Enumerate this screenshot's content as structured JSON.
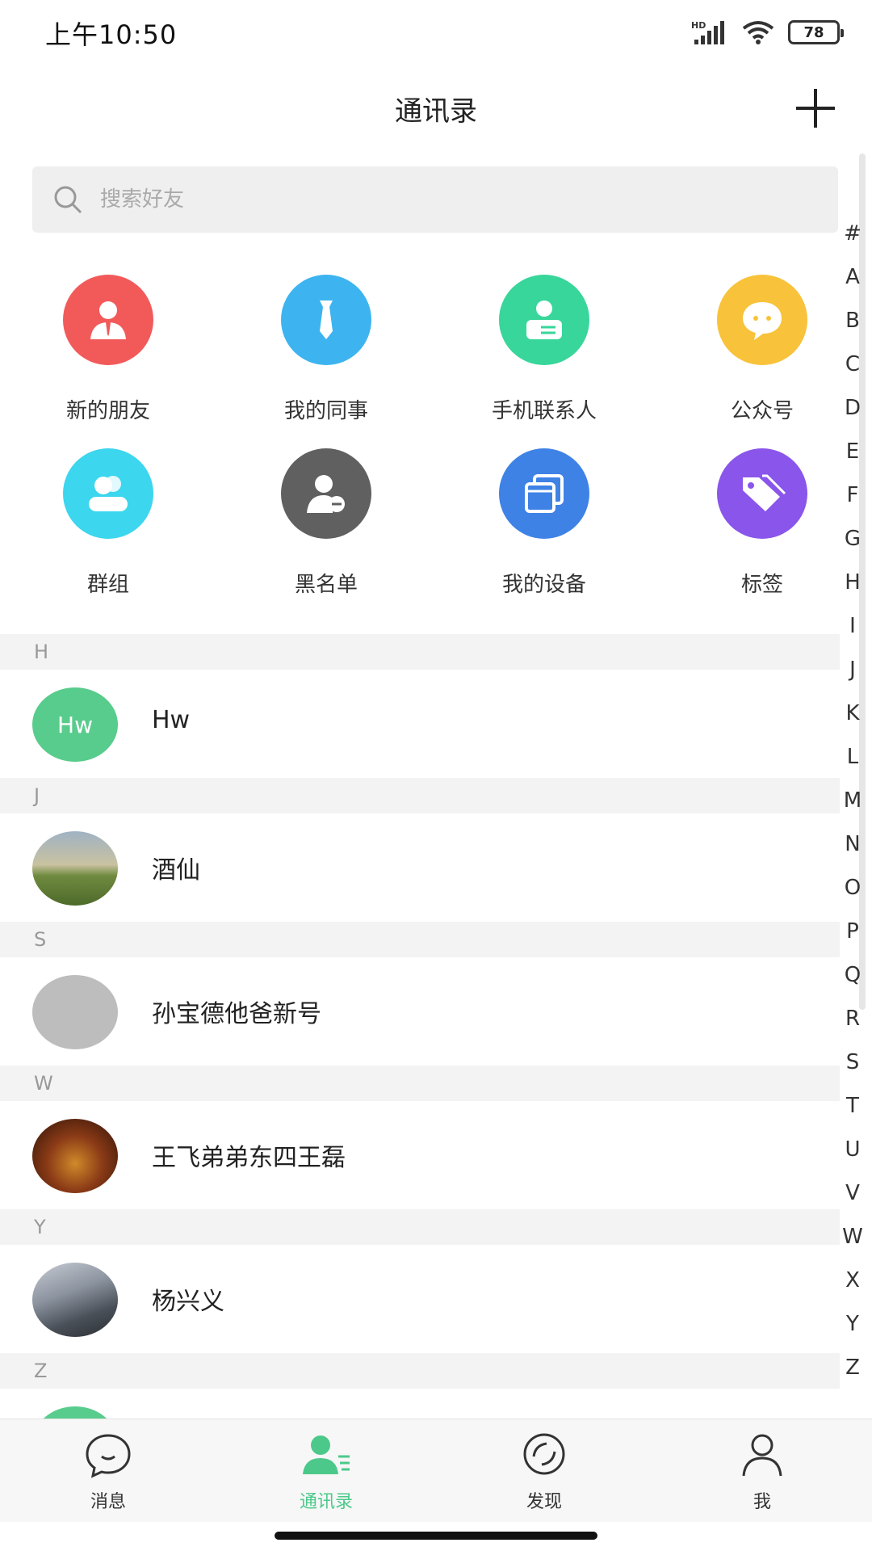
{
  "status_bar": {
    "time": "上午10:50",
    "network": "HD",
    "battery": "78"
  },
  "header": {
    "title": "通讯录",
    "add_icon": "plus-icon"
  },
  "search": {
    "placeholder": "搜索好友",
    "icon": "search-icon"
  },
  "quick_actions": [
    {
      "label": "新的朋友",
      "icon": "new-friend-icon",
      "color": "#f25a5a"
    },
    {
      "label": "我的同事",
      "icon": "colleague-icon",
      "color": "#3db4f0"
    },
    {
      "label": "手机联系人",
      "icon": "phone-contacts-icon",
      "color": "#38d69a"
    },
    {
      "label": "公众号",
      "icon": "official-account-icon",
      "color": "#f8c23a"
    },
    {
      "label": "群组",
      "icon": "group-icon",
      "color": "#3cd6ee"
    },
    {
      "label": "黑名单",
      "icon": "blacklist-icon",
      "color": "#606060"
    },
    {
      "label": "我的设备",
      "icon": "device-icon",
      "color": "#3f82e6"
    },
    {
      "label": "标签",
      "icon": "tag-icon",
      "color": "#8a55ea"
    }
  ],
  "index_letters": [
    "#",
    "A",
    "B",
    "C",
    "D",
    "E",
    "F",
    "G",
    "H",
    "I",
    "J",
    "K",
    "L",
    "M",
    "N",
    "O",
    "P",
    "Q",
    "R",
    "S",
    "T",
    "U",
    "V",
    "W",
    "X",
    "Y",
    "Z"
  ],
  "contact_sections": [
    {
      "letter": "H",
      "contacts": [
        {
          "name": "Hw",
          "avatar_text": "Hw",
          "avatar_color": "#58cc8c"
        }
      ]
    },
    {
      "letter": "J",
      "contacts": [
        {
          "name": "酒仙",
          "avatar_text": "",
          "avatar_color": "#7a8a5a"
        }
      ]
    },
    {
      "letter": "S",
      "contacts": [
        {
          "name": "孙宝德他爸新号",
          "avatar_text": "",
          "avatar_color": "#bdbdbd"
        }
      ]
    },
    {
      "letter": "W",
      "contacts": [
        {
          "name": "王飞弟弟东四王磊",
          "avatar_text": "",
          "avatar_color": "#6b3a1e"
        }
      ]
    },
    {
      "letter": "Y",
      "contacts": [
        {
          "name": "杨兴义",
          "avatar_text": "",
          "avatar_color": "#6f7a88"
        }
      ]
    },
    {
      "letter": "Z",
      "contacts": []
    }
  ],
  "bottom_nav": [
    {
      "label": "消息",
      "icon": "message-icon",
      "active": false
    },
    {
      "label": "通讯录",
      "icon": "contacts-icon",
      "active": true
    },
    {
      "label": "发现",
      "icon": "discover-icon",
      "active": false
    },
    {
      "label": "我",
      "icon": "profile-icon",
      "active": false
    }
  ],
  "colors": {
    "accent": "#4cc98a",
    "section_bg": "#f3f3f3"
  }
}
